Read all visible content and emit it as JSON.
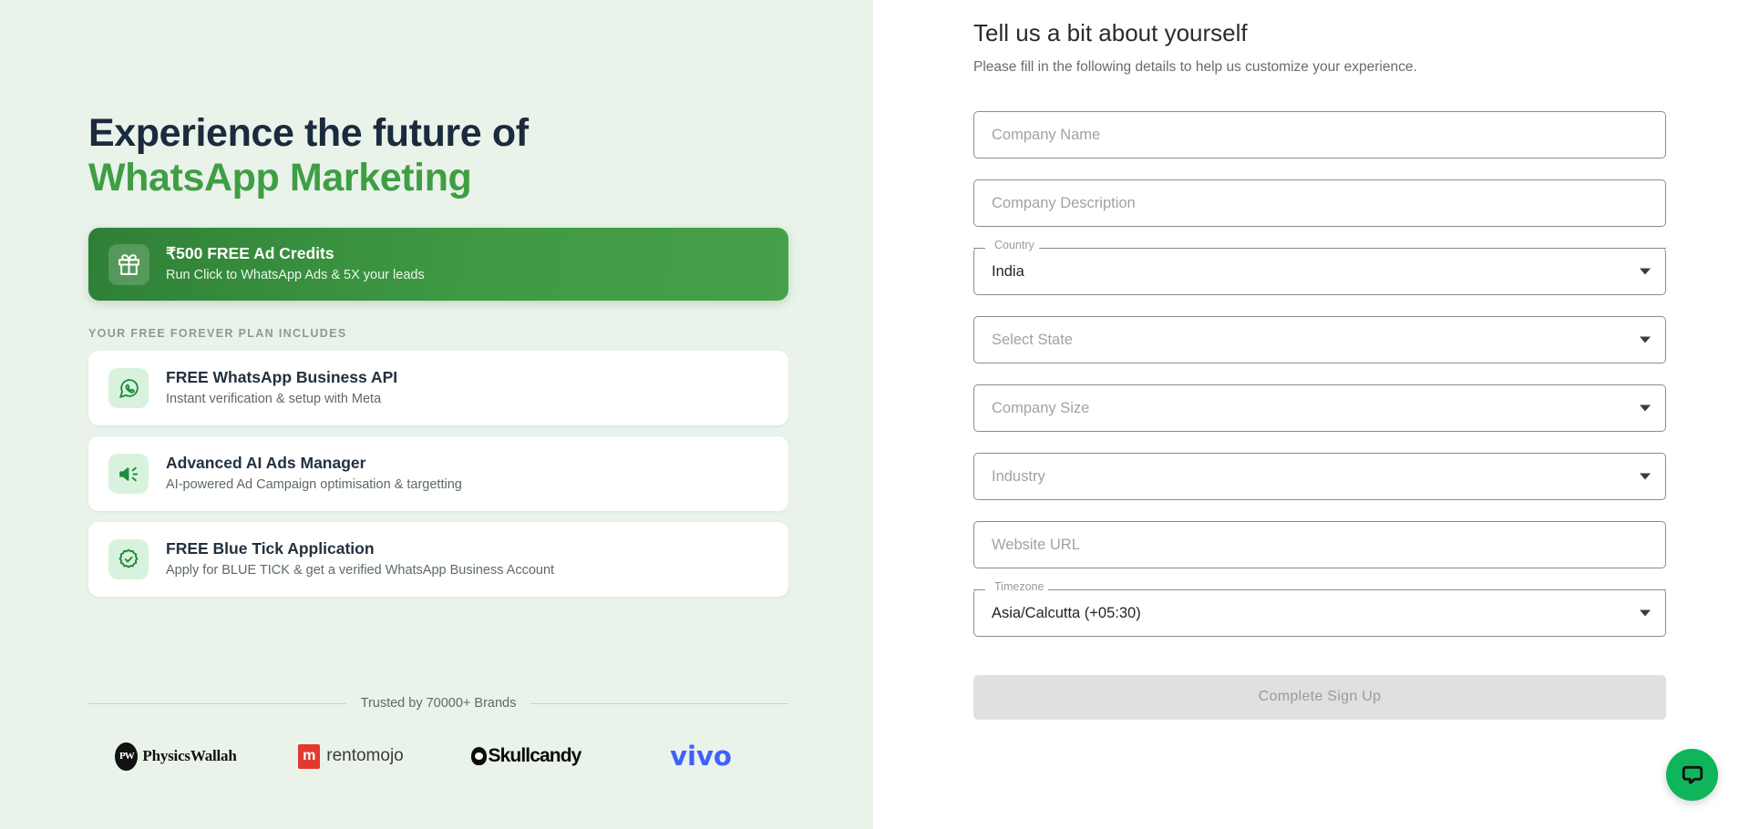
{
  "left": {
    "headline_line1": "Experience the future of",
    "headline_line2": "WhatsApp Marketing",
    "promo": {
      "icon": "gift-icon",
      "title": "₹500 FREE Ad Credits",
      "subtitle": "Run Click to WhatsApp Ads & 5X your leads"
    },
    "section_label": "YOUR FREE FOREVER PLAN INCLUDES",
    "features": [
      {
        "icon": "whatsapp-icon",
        "title": "FREE WhatsApp Business API",
        "subtitle": "Instant verification & setup with Meta"
      },
      {
        "icon": "megaphone-icon",
        "title": "Advanced AI Ads Manager",
        "subtitle": "AI-powered Ad Campaign optimisation & targetting"
      },
      {
        "icon": "verified-badge-icon",
        "title": "FREE Blue Tick Application",
        "subtitle": "Apply for BLUE TICK & get a verified WhatsApp Business Account"
      }
    ],
    "trust_text": "Trusted by 70000+ Brands",
    "brands": [
      {
        "name": "PhysicsWallah",
        "mark": "PW"
      },
      {
        "name": "rentomojo",
        "mark": "m"
      },
      {
        "name": "Skullcandy",
        "mark": "skull"
      },
      {
        "name": "vivo",
        "mark": "vivo"
      }
    ]
  },
  "right": {
    "title": "Tell us a bit about yourself",
    "subtitle": "Please fill in the following details to help us customize your experience.",
    "fields": [
      {
        "name": "company-name",
        "type": "text",
        "label": "",
        "value": "",
        "placeholder": "Company Name"
      },
      {
        "name": "company-description",
        "type": "text",
        "label": "",
        "value": "",
        "placeholder": "Company Description"
      },
      {
        "name": "country",
        "type": "select",
        "label": "Country",
        "value": "India",
        "placeholder": ""
      },
      {
        "name": "state",
        "type": "select",
        "label": "",
        "value": "",
        "placeholder": "Select State"
      },
      {
        "name": "company-size",
        "type": "select",
        "label": "",
        "value": "",
        "placeholder": "Company Size"
      },
      {
        "name": "industry",
        "type": "select",
        "label": "",
        "value": "",
        "placeholder": "Industry"
      },
      {
        "name": "website-url",
        "type": "text",
        "label": "",
        "value": "",
        "placeholder": "Website URL"
      },
      {
        "name": "timezone",
        "type": "select",
        "label": "Timezone",
        "value": "Asia/Calcutta (+05:30)",
        "placeholder": ""
      }
    ],
    "submit_label": "Complete Sign Up",
    "submit_disabled": true
  },
  "chat": {
    "icon": "chat-bubble-icon",
    "color": "#0fb55a"
  },
  "colors": {
    "left_bg": "#e9f3ea",
    "accent_green": "#3f9e44",
    "banner_from": "#2f8037",
    "banner_to": "#45a049",
    "headline_dark": "#1b2a3d"
  }
}
